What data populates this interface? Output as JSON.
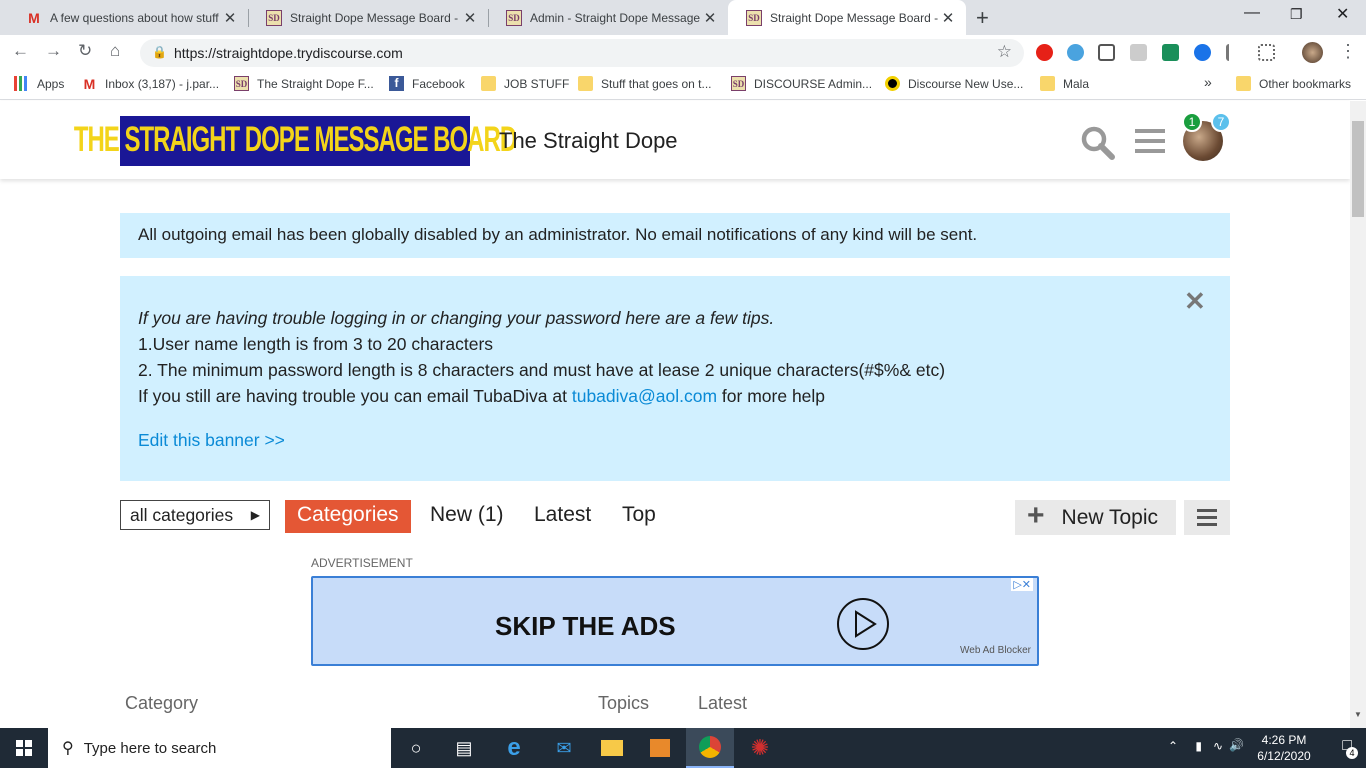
{
  "browser": {
    "tabs": [
      {
        "title": "A few questions about how stuff",
        "favicon": "gmail-icon",
        "active": false
      },
      {
        "title": "Straight Dope Message Board - In",
        "favicon": "sd-icon",
        "active": false
      },
      {
        "title": "Admin - Straight Dope Message B",
        "favicon": "sd-icon",
        "active": false
      },
      {
        "title": "Straight Dope Message Board - Y",
        "favicon": "sd-icon",
        "active": true
      }
    ],
    "new_tab": "+",
    "close": "✕",
    "url": "https://straightdope.trydiscourse.com",
    "bookmarks": [
      {
        "label": "Apps",
        "icon": "apps-icon"
      },
      {
        "label": "Inbox (3,187) - j.par...",
        "icon": "gmail-icon"
      },
      {
        "label": "The Straight Dope F...",
        "icon": "sd-icon"
      },
      {
        "label": "Facebook",
        "icon": "facebook-icon"
      },
      {
        "label": "JOB STUFF",
        "icon": "folder-icon"
      },
      {
        "label": "Stuff that goes on t...",
        "icon": "folder-icon"
      },
      {
        "label": "DISCOURSE Admin...",
        "icon": "sd-icon"
      },
      {
        "label": "Discourse New Use...",
        "icon": "discourse-icon"
      },
      {
        "label": "Mala",
        "icon": "folder-icon"
      }
    ],
    "bookmarks_more": "»",
    "other_bookmarks": "Other bookmarks"
  },
  "header": {
    "logo_text": "THE STRAIGHT DOPE MESSAGE BOARD",
    "site_title": "The Straight Dope",
    "badge_green": "1",
    "badge_blue": "7"
  },
  "banners": {
    "email_disabled": "All outgoing email has been globally disabled by an administrator. No email notifications of any kind will be sent.",
    "tip_intro": "If you are having trouble logging in or changing your password here are a few tips.",
    "tip_1": "1.User name length is from 3 to 20 characters",
    "tip_2": "2. The minimum password length is 8 characters and must have at lease 2 unique characters(#$%& etc)",
    "tip_3_pre": "If you still are having trouble you can email TubaDiva at ",
    "tip_3_link": "tubadiva@aol.com",
    "tip_3_post": " for more help",
    "edit_link": "Edit this banner >>",
    "close": "✕"
  },
  "nav": {
    "category_dropdown": "all categories",
    "items": [
      "Categories",
      "New (1)",
      "Latest",
      "Top"
    ],
    "new_topic": "New Topic"
  },
  "ad": {
    "label": "ADVERTISEMENT",
    "headline": "SKIP THE ADS",
    "brand": "Web Ad Blocker"
  },
  "table": {
    "col_category": "Category",
    "col_topics": "Topics",
    "col_latest": "Latest"
  },
  "taskbar": {
    "search_placeholder": "Type here to search",
    "time": "4:26 PM",
    "date": "6/12/2020",
    "notifications": "4"
  }
}
